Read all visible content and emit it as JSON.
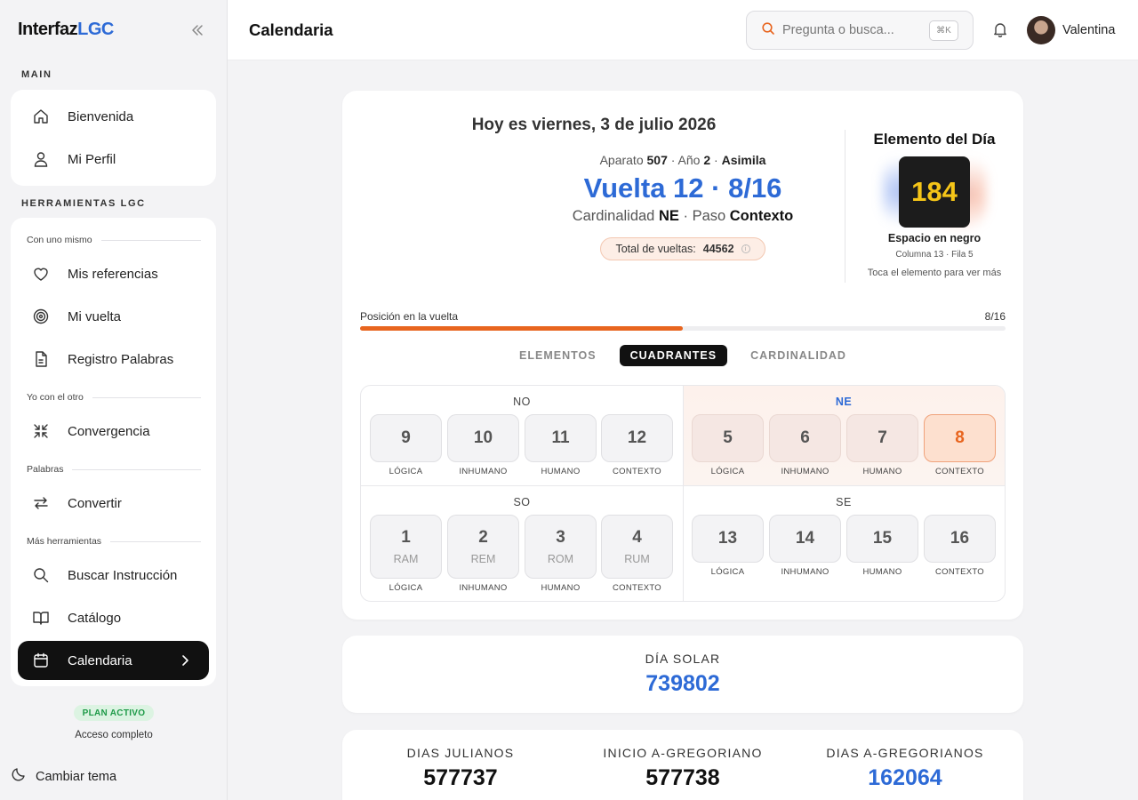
{
  "app": {
    "logo_main": "Interfaz",
    "logo_accent": "LGC"
  },
  "sidebar": {
    "main_title": "MAIN",
    "main_items": [
      {
        "label": "Bienvenida",
        "icon": "home-icon"
      },
      {
        "label": "Mi Perfil",
        "icon": "user-icon"
      }
    ],
    "tools_title": "HERRAMIENTAS LGC",
    "groups": [
      "Con uno mismo",
      "Yo con el otro",
      "Palabras",
      "Más herramientas"
    ],
    "tool_items": [
      {
        "label": "Mis referencias",
        "icon": "heart-icon"
      },
      {
        "label": "Mi vuelta",
        "icon": "spiral-icon"
      },
      {
        "label": "Registro Palabras",
        "icon": "document-icon"
      },
      {
        "label": "Convergencia",
        "icon": "converge-icon"
      },
      {
        "label": "Convertir",
        "icon": "swap-icon"
      },
      {
        "label": "Buscar Instrucción",
        "icon": "search-icon"
      },
      {
        "label": "Catálogo",
        "icon": "book-icon"
      },
      {
        "label": "Calendaria",
        "icon": "calendar-icon"
      }
    ],
    "plan_badge": "PLAN ACTIVO",
    "plan_sub": "Acceso completo",
    "theme_toggle": "Cambiar tema"
  },
  "header": {
    "title": "Calendaria",
    "search_placeholder": "Pregunta o busca...",
    "search_shortcut": "⌘K",
    "user_name": "Valentina"
  },
  "today": {
    "heading": "Hoy es viernes, 3 de julio 2026",
    "aparato_label": "Aparato",
    "aparato_value": "507",
    "anio_label": "Año",
    "anio_value": "2",
    "asimila": "Asimila",
    "vuelta": "Vuelta 12 · 8/16",
    "cardinalidad_label": "Cardinalidad",
    "cardinalidad_value": "NE",
    "paso_label": "Paso",
    "paso_value": "Contexto",
    "total_label": "Total de vueltas:",
    "total_value": "44562"
  },
  "element": {
    "title": "Elemento del Día",
    "number": "184",
    "name": "Espacio en negro",
    "position": "Columna 13 · Fila 5",
    "hint": "Toca el elemento para ver más"
  },
  "position": {
    "label": "Posición en la vuelta",
    "value": "8/16",
    "fraction": 0.5
  },
  "tabs": [
    {
      "label": "ELEMENTOS",
      "active": false
    },
    {
      "label": "CUADRANTES",
      "active": true
    },
    {
      "label": "CARDINALIDAD",
      "active": false
    }
  ],
  "quadrants": [
    {
      "name": "NO",
      "cells": [
        {
          "num": "9",
          "cap": "LÓGICA"
        },
        {
          "num": "10",
          "cap": "INHUMANO"
        },
        {
          "num": "11",
          "cap": "HUMANO"
        },
        {
          "num": "12",
          "cap": "CONTEXTO"
        }
      ]
    },
    {
      "name": "NE",
      "cells": [
        {
          "num": "5",
          "cap": "LÓGICA"
        },
        {
          "num": "6",
          "cap": "INHUMANO"
        },
        {
          "num": "7",
          "cap": "HUMANO"
        },
        {
          "num": "8",
          "cap": "CONTEXTO"
        }
      ]
    },
    {
      "name": "SO",
      "cells": [
        {
          "num": "1",
          "sub": "RAM",
          "cap": "LÓGICA"
        },
        {
          "num": "2",
          "sub": "REM",
          "cap": "INHUMANO"
        },
        {
          "num": "3",
          "sub": "ROM",
          "cap": "HUMANO"
        },
        {
          "num": "4",
          "sub": "RUM",
          "cap": "CONTEXTO"
        }
      ]
    },
    {
      "name": "SE",
      "cells": [
        {
          "num": "13",
          "cap": "LÓGICA"
        },
        {
          "num": "14",
          "cap": "INHUMANO"
        },
        {
          "num": "15",
          "cap": "HUMANO"
        },
        {
          "num": "16",
          "cap": "CONTEXTO"
        }
      ]
    }
  ],
  "solar": {
    "label": "DÍA SOLAR",
    "value": "739802"
  },
  "stats": [
    {
      "label": "DIAS JULIANOS",
      "value": "577737"
    },
    {
      "label": "INICIO A-GREGORIANO",
      "value": "577738"
    },
    {
      "label": "DIAS A-GREGORIANOS",
      "value": "162064"
    }
  ],
  "colors": {
    "accent_blue": "#2d6ad6",
    "accent_orange": "#e8651f",
    "element_gold": "#f5c518",
    "plan_green": "#1e9a48"
  }
}
